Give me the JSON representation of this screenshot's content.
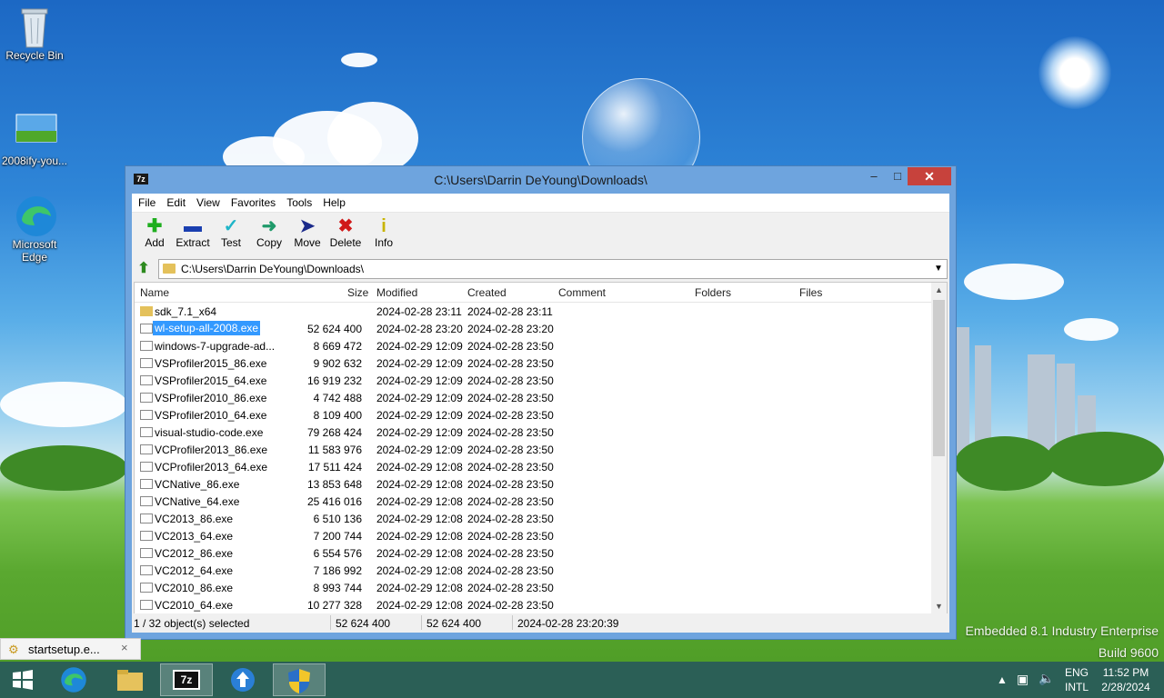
{
  "desktop": {
    "icons": [
      {
        "label": "Recycle Bin",
        "icon": "recycle-bin-icon"
      },
      {
        "label": "2008ify-you...",
        "icon": "image-file-icon"
      },
      {
        "label": "Microsoft\nEdge",
        "icon": "edge-icon"
      }
    ],
    "watermark_line1": "Embedded 8.1 Industry Enterprise",
    "watermark_line2": "Build 9600"
  },
  "window": {
    "app_icon_text": "7z",
    "title": "C:\\Users\\Darrin DeYoung\\Downloads\\",
    "menu": [
      "File",
      "Edit",
      "View",
      "Favorites",
      "Tools",
      "Help"
    ],
    "toolbar": [
      {
        "label": "Add",
        "icon": "add-icon",
        "color": "#1fae1f"
      },
      {
        "label": "Extract",
        "icon": "extract-icon",
        "color": "#1a3fb0"
      },
      {
        "label": "Test",
        "icon": "test-icon",
        "color": "#1fb5c8"
      },
      {
        "label": "Copy",
        "icon": "copy-icon",
        "color": "#1f9a6a"
      },
      {
        "label": "Move",
        "icon": "move-icon",
        "color": "#1a2a8a"
      },
      {
        "label": "Delete",
        "icon": "delete-icon",
        "color": "#d01818"
      },
      {
        "label": "Info",
        "icon": "info-icon",
        "color": "#c8b400"
      }
    ],
    "address": "C:\\Users\\Darrin DeYoung\\Downloads\\",
    "columns": [
      "Name",
      "Size",
      "Modified",
      "Created",
      "Comment",
      "Folders",
      "Files"
    ],
    "rows": [
      {
        "name": "sdk_7.1_x64",
        "size": "",
        "modified": "2024-02-28 23:11",
        "created": "2024-02-28 23:11",
        "type": "folder"
      },
      {
        "name": "wl-setup-all-2008.exe",
        "size": "52 624 400",
        "modified": "2024-02-28 23:20",
        "created": "2024-02-28 23:20",
        "type": "file",
        "selected": true
      },
      {
        "name": "windows-7-upgrade-ad...",
        "size": "8 669 472",
        "modified": "2024-02-29 12:09",
        "created": "2024-02-28 23:50",
        "type": "file"
      },
      {
        "name": "VSProfiler2015_86.exe",
        "size": "9 902 632",
        "modified": "2024-02-29 12:09",
        "created": "2024-02-28 23:50",
        "type": "file"
      },
      {
        "name": "VSProfiler2015_64.exe",
        "size": "16 919 232",
        "modified": "2024-02-29 12:09",
        "created": "2024-02-28 23:50",
        "type": "file"
      },
      {
        "name": "VSProfiler2010_86.exe",
        "size": "4 742 488",
        "modified": "2024-02-29 12:09",
        "created": "2024-02-28 23:50",
        "type": "file"
      },
      {
        "name": "VSProfiler2010_64.exe",
        "size": "8 109 400",
        "modified": "2024-02-29 12:09",
        "created": "2024-02-28 23:50",
        "type": "file"
      },
      {
        "name": "visual-studio-code.exe",
        "size": "79 268 424",
        "modified": "2024-02-29 12:09",
        "created": "2024-02-28 23:50",
        "type": "file"
      },
      {
        "name": "VCProfiler2013_86.exe",
        "size": "11 583 976",
        "modified": "2024-02-29 12:09",
        "created": "2024-02-28 23:50",
        "type": "file"
      },
      {
        "name": "VCProfiler2013_64.exe",
        "size": "17 511 424",
        "modified": "2024-02-29 12:08",
        "created": "2024-02-28 23:50",
        "type": "file"
      },
      {
        "name": "VCNative_86.exe",
        "size": "13 853 648",
        "modified": "2024-02-29 12:08",
        "created": "2024-02-28 23:50",
        "type": "file"
      },
      {
        "name": "VCNative_64.exe",
        "size": "25 416 016",
        "modified": "2024-02-29 12:08",
        "created": "2024-02-28 23:50",
        "type": "file"
      },
      {
        "name": "VC2013_86.exe",
        "size": "6 510 136",
        "modified": "2024-02-29 12:08",
        "created": "2024-02-28 23:50",
        "type": "file"
      },
      {
        "name": "VC2013_64.exe",
        "size": "7 200 744",
        "modified": "2024-02-29 12:08",
        "created": "2024-02-28 23:50",
        "type": "file"
      },
      {
        "name": "VC2012_86.exe",
        "size": "6 554 576",
        "modified": "2024-02-29 12:08",
        "created": "2024-02-28 23:50",
        "type": "file"
      },
      {
        "name": "VC2012_64.exe",
        "size": "7 186 992",
        "modified": "2024-02-29 12:08",
        "created": "2024-02-28 23:50",
        "type": "file"
      },
      {
        "name": "VC2010_86.exe",
        "size": "8 993 744",
        "modified": "2024-02-29 12:08",
        "created": "2024-02-28 23:50",
        "type": "file"
      },
      {
        "name": "VC2010_64.exe",
        "size": "10 277 328",
        "modified": "2024-02-29 12:08",
        "created": "2024-02-28 23:50",
        "type": "file"
      }
    ],
    "status": {
      "selection": "1 / 32 object(s) selected",
      "size": "52 624 400",
      "packed": "52 624 400",
      "date": "2024-02-28 23:20:39"
    }
  },
  "toast": {
    "label": "startsetup.e...",
    "close": "×"
  },
  "taskbar": {
    "items": [
      "start-button",
      "edge",
      "file-explorer",
      "7zip",
      "update",
      "shield"
    ],
    "lang_top": "ENG",
    "lang_bottom": "INTL",
    "time": "11:52 PM",
    "date": "2/28/2024"
  },
  "colors": {
    "selection": "#3399ff",
    "window_frame": "#6ea4de",
    "close_button": "#c7423c",
    "taskbar": "#285a5a"
  }
}
